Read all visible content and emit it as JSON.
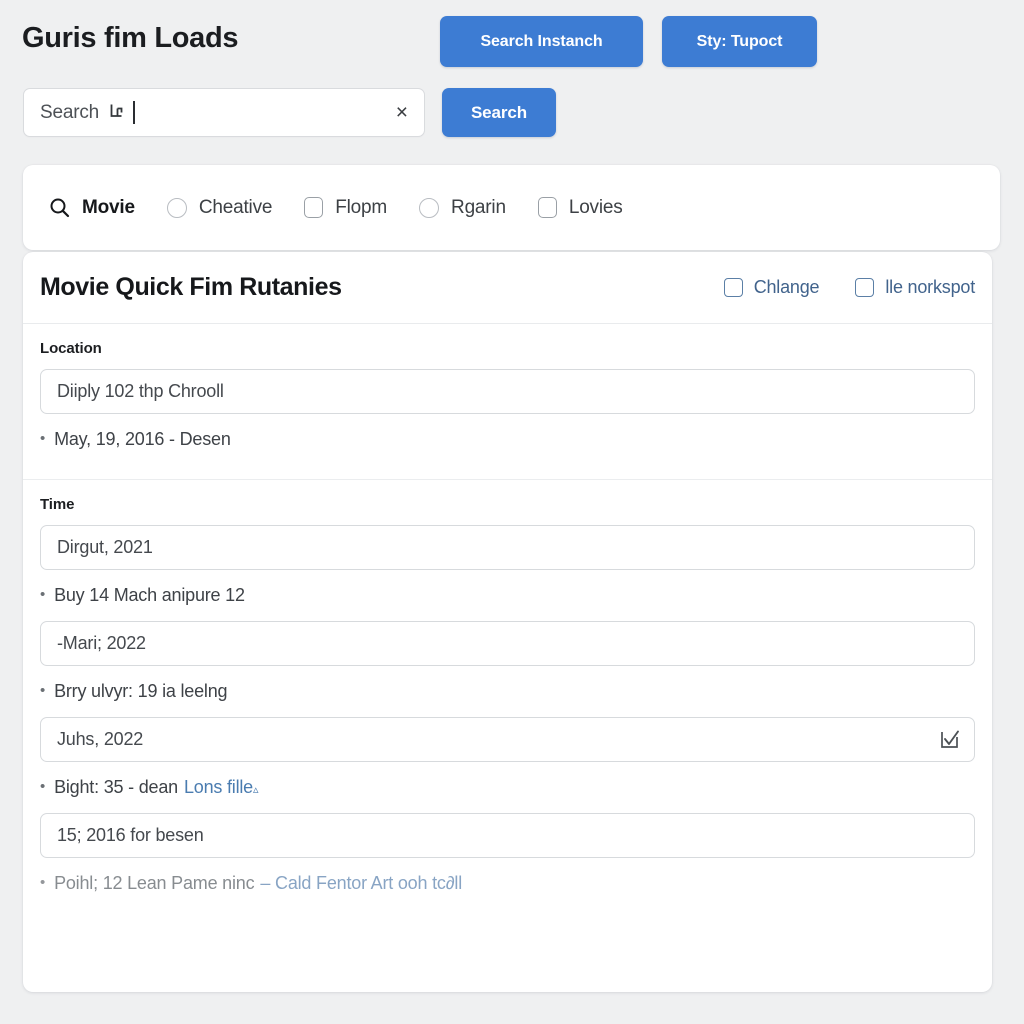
{
  "header": {
    "title": "Guris fim Loads",
    "buttons": [
      {
        "id": "search-instance",
        "label": "Search Instanch"
      },
      {
        "id": "sty-tupoct",
        "label": "Sty: Tupoct"
      },
      {
        "id": "search",
        "label": "Search"
      }
    ],
    "search": {
      "text": "Search",
      "glyph": "⌐",
      "clear_icon": "×",
      "placeholder": "Search"
    }
  },
  "filters": [
    {
      "label": "Movie",
      "mark": "search-icon",
      "active": true
    },
    {
      "label": "Cheative",
      "mark": "circle",
      "active": false
    },
    {
      "label": "Flopm",
      "mark": "square",
      "active": false
    },
    {
      "label": "Rgarin",
      "mark": "circle",
      "active": false
    },
    {
      "label": "Lovies",
      "mark": "square",
      "active": false
    }
  ],
  "card": {
    "title": "Movie Quick Fim Rutanies",
    "head_checks": [
      {
        "label": "Chlange",
        "checked": false
      },
      {
        "label": "lle norkspot",
        "checked": false
      }
    ],
    "sections": [
      {
        "label": "Location",
        "input_value": "Diiply 102 thp Chrooll",
        "note": "May, 19, 2016 - Desen"
      },
      {
        "label": "Time",
        "input_value": "Dirgut, 2021",
        "note": "Buy 14 Mach anipure 12"
      }
    ],
    "rows": [
      {
        "type": "input",
        "value": "-Mari; 2022",
        "icon": ""
      },
      {
        "type": "note",
        "value": "Brry ulvyr: 19 ia leelng"
      },
      {
        "type": "input",
        "value": "Juhs, 2022",
        "icon": "checkbox-check-icon"
      },
      {
        "type": "note",
        "value": "Bight: 35 - dean",
        "link": "Lons fille",
        "sup": "▵"
      },
      {
        "type": "input",
        "value": "15; 2016 for besen",
        "icon": ""
      },
      {
        "type": "note_clipped",
        "value": "Poihl; 12 Lean Pame ninc",
        "link": "– Cald Fentor Art ooh tc∂ll"
      }
    ]
  },
  "colors": {
    "accent": "#3d7cd3",
    "link": "#4a7cb0",
    "check_blue": "#41638c",
    "page_bg": "#eff0f1",
    "card_bg": "#ffffff",
    "text": "#16181b"
  }
}
